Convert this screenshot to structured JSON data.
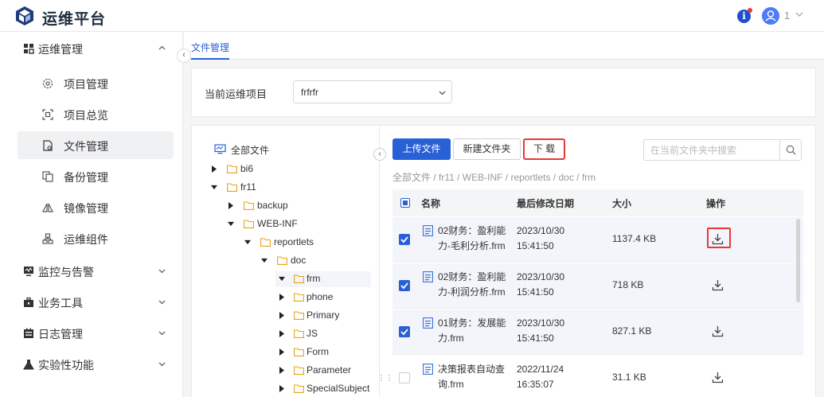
{
  "header": {
    "app_title": "运维平台",
    "info_icon": "i",
    "user_name": "1",
    "accent": "#2a60d6",
    "alert_color": "#e53935"
  },
  "sidebar": {
    "groups": [
      {
        "label": "运维管理",
        "icon": "grid-icon",
        "expanded": true
      },
      {
        "label": "监控与告警",
        "icon": "monitor-icon",
        "expanded": false
      },
      {
        "label": "业务工具",
        "icon": "toolbox-icon",
        "expanded": false
      },
      {
        "label": "日志管理",
        "icon": "log-icon",
        "expanded": false
      },
      {
        "label": "实验性功能",
        "icon": "flask-icon",
        "expanded": false
      }
    ],
    "items": [
      {
        "label": "项目管理",
        "icon": "gear-icon"
      },
      {
        "label": "项目总览",
        "icon": "overview-icon"
      },
      {
        "label": "文件管理",
        "icon": "file-manage-icon",
        "active": true
      },
      {
        "label": "备份管理",
        "icon": "backup-icon"
      },
      {
        "label": "镜像管理",
        "icon": "mirror-icon"
      },
      {
        "label": "运维组件",
        "icon": "component-icon"
      }
    ],
    "collapse_glyph": "‹"
  },
  "tabs": [
    {
      "label": "文件管理",
      "active": true
    }
  ],
  "project": {
    "label": "当前运维项目",
    "value": "frfrfr"
  },
  "tree": {
    "root_label": "全部文件",
    "collapse_glyph": "‹",
    "drag_glyph": "⋮⋮",
    "nodes": [
      {
        "label": "bi6",
        "expanded": false
      },
      {
        "label": "fr11",
        "expanded": true
      },
      {
        "label": "backup",
        "expanded": false
      },
      {
        "label": "WEB-INF",
        "expanded": true
      },
      {
        "label": "reportlets",
        "expanded": true
      },
      {
        "label": "doc",
        "expanded": true
      },
      {
        "label": "frm",
        "expanded": true,
        "selected": true
      },
      {
        "label": "phone",
        "expanded": false
      },
      {
        "label": "Primary",
        "expanded": false
      },
      {
        "label": "JS",
        "expanded": false
      },
      {
        "label": "Form",
        "expanded": false
      },
      {
        "label": "Parameter",
        "expanded": false
      },
      {
        "label": "SpecialSubject",
        "expanded": false
      }
    ]
  },
  "toolbar": {
    "upload_label": "上传文件",
    "new_folder_label": "新建文件夹",
    "download_label": "下 载",
    "search_placeholder": "在当前文件夹中搜索"
  },
  "breadcrumb": "全部文件 / fr11 / WEB-INF / reportlets / doc / frm",
  "table": {
    "columns": [
      "名称",
      "最后修改日期",
      "大小",
      "操作"
    ],
    "rows": [
      {
        "name": "02财务：盈利能力-毛利分析.frm",
        "date": "2023/10/30 15:41:50",
        "size": "1137.4 KB",
        "checked": true
      },
      {
        "name": "02财务：盈利能力-利润分析.frm",
        "date": "2023/10/30 15:41:50",
        "size": "718 KB",
        "checked": true
      },
      {
        "name": "01财务：发展能力.frm",
        "date": "2023/10/30 15:41:50",
        "size": "827.1 KB",
        "checked": true
      },
      {
        "name": "决策报表自动查询.frm",
        "date": "2022/11/24 16:35:07",
        "size": "31.1 KB",
        "checked": false
      }
    ]
  }
}
